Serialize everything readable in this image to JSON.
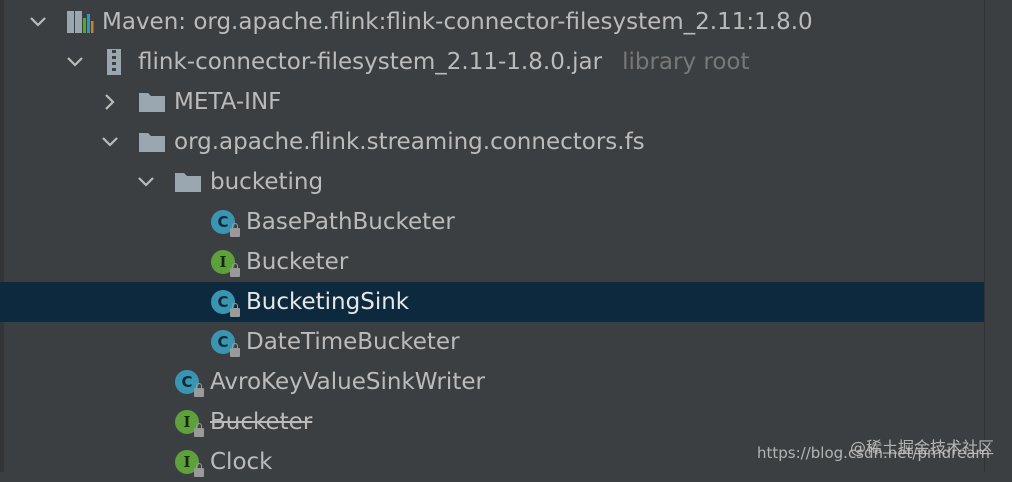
{
  "tree": {
    "rows": [
      {
        "label": "Maven: org.apache.flink:flink-connector-filesystem_2.11:1.8.0",
        "icon": "maven-library-icon"
      },
      {
        "label": "flink-connector-filesystem_2.11-1.8.0.jar",
        "suffix": "library root",
        "icon": "jar-icon"
      },
      {
        "label": "META-INF",
        "icon": "folder-icon"
      },
      {
        "label": "org.apache.flink.streaming.connectors.fs",
        "icon": "package-icon"
      },
      {
        "label": "bucketing",
        "icon": "package-icon"
      },
      {
        "label": "BasePathBucketer",
        "icon": "class-icon",
        "badge": "C"
      },
      {
        "label": "Bucketer",
        "icon": "interface-icon",
        "badge": "I"
      },
      {
        "label": "BucketingSink",
        "icon": "class-icon",
        "badge": "C"
      },
      {
        "label": "DateTimeBucketer",
        "icon": "class-icon",
        "badge": "C"
      },
      {
        "label": "AvroKeyValueSinkWriter",
        "icon": "class-icon",
        "badge": "C"
      },
      {
        "label": "Bucketer",
        "icon": "interface-icon",
        "badge": "I"
      },
      {
        "label": "Clock",
        "icon": "interface-icon",
        "badge": "I"
      }
    ]
  },
  "watermark": {
    "line1": "@稀土掘金技术社区",
    "line2": "https://blog.csdn.net/pmdream"
  },
  "colors": {
    "background": "#3c3f41",
    "selection": "#0d293e",
    "text": "#bbbbbb",
    "muted_text": "#787878",
    "class_badge": "#3a95b3",
    "interface_badge": "#5ea03b"
  }
}
